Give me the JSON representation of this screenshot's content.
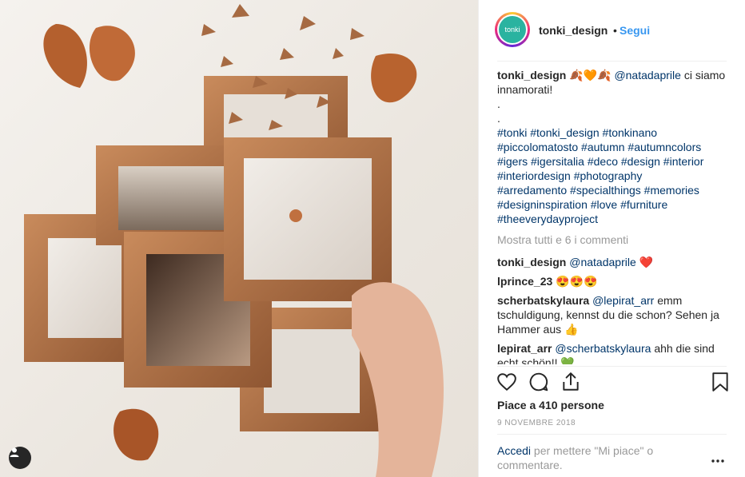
{
  "header": {
    "avatar_text": "tonki",
    "username": "tonki_design",
    "separator": "•",
    "follow_label": "Segui"
  },
  "caption": {
    "username": "tonki_design",
    "emojis": "🍂🧡🍂",
    "mention": "@natadaprile",
    "text": "ci siamo innamorati!",
    "dot1": ".",
    "dot2": ".",
    "hashtags": [
      "#tonki #tonki_design #tonkinano",
      "#piccolomatosto #autumn #autumncolors",
      "#igers #igersitalia #deco #design #interior",
      "#interiordesign #photography",
      "#arredamento #specialthings #memories",
      "#designinspiration #love #furniture",
      "#theeverydayproject"
    ]
  },
  "show_all": "Mostra tutti e 6 i commenti",
  "comments": [
    {
      "username": "tonki_design",
      "mention": "@natadaprile",
      "text": "❤️"
    },
    {
      "username": "lprince_23",
      "mention": "",
      "text": "😍😍😍"
    },
    {
      "username": "scherbatskylaura",
      "mention": "@lepirat_arr",
      "text": "emm tschuldigung, kennst du die schon? Sehen ja Hammer aus 👍"
    },
    {
      "username": "lepirat_arr",
      "mention": "@scherbatskylaura",
      "text": "ahh die sind echt schön!! 💚"
    }
  ],
  "likes_text": "Piace a 410 persone",
  "date_text": "9 NOVEMBRE 2018",
  "add_comment": {
    "login": "Accedi",
    "text": "per mettere \"Mi piace\" o commentare."
  },
  "icons": {
    "like": "heart-icon",
    "comment": "comment-icon",
    "share": "share-icon",
    "save": "bookmark-icon",
    "more": "more-icon",
    "user_tag": "user-icon"
  },
  "colors": {
    "link": "#3897f0",
    "hashtag": "#003569",
    "muted": "#999999",
    "text": "#262626"
  }
}
